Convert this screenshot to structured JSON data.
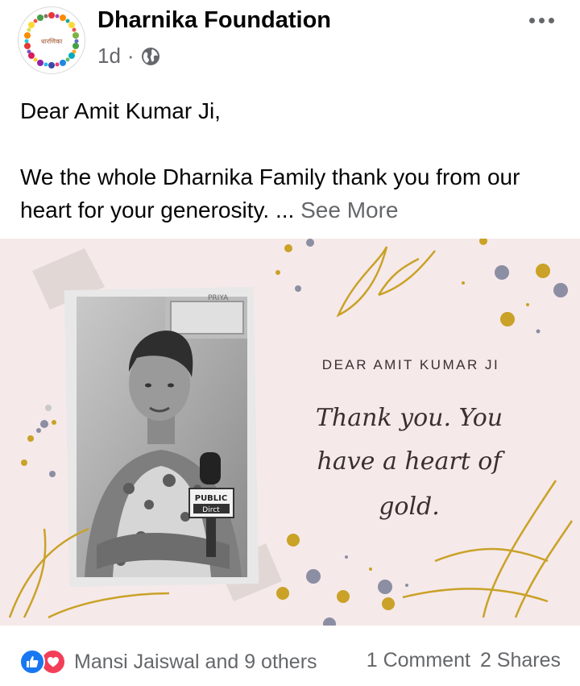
{
  "post": {
    "page_name": "Dharnika Foundation",
    "time": "1d",
    "separator": "·",
    "privacy_icon": "globe-icon",
    "more_icon": "more-options-icon",
    "avatar_text": "धारणिका",
    "text_lines": [
      "Dear Amit Kumar Ji,",
      "We the whole Dharnika Family thank you from our heart for your generosity."
    ],
    "ellipsis": "...",
    "see_more": "See More"
  },
  "image": {
    "card_heading": "DEAR AMIT KUMAR JI",
    "script_lines": [
      "Thank you. You",
      "have a heart of",
      "gold."
    ],
    "mic_label_top": "PUBLIC",
    "mic_label_bottom": "Dirct",
    "frame_label": "PRIYA",
    "colors": {
      "background": "#f5e6e7",
      "gold": "#c9a227",
      "slate": "#8c8ea3",
      "ink": "#3a3030"
    }
  },
  "footer": {
    "reactions": [
      "like-icon",
      "love-icon"
    ],
    "reactors_text": "Mansi Jaiswal and 9 others",
    "comments_text": "1 Comment",
    "shares_text": "2 Shares"
  }
}
